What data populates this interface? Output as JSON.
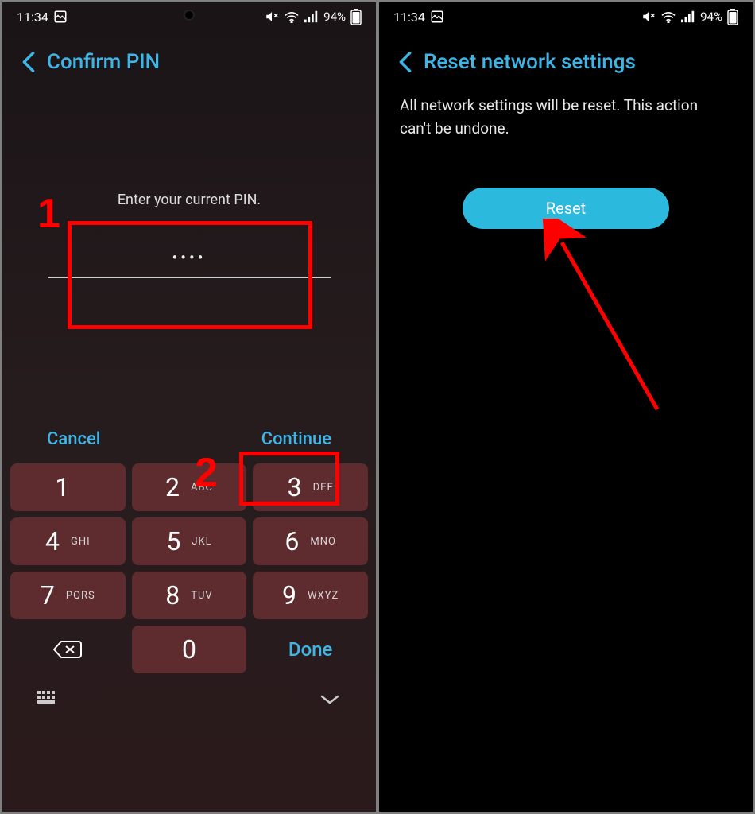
{
  "status": {
    "time": "11:34",
    "battery": "94%"
  },
  "left": {
    "title": "Confirm PIN",
    "prompt": "Enter your current PIN.",
    "dots": "••••",
    "cancel": "Cancel",
    "continue": "Continue",
    "keys": [
      {
        "num": "1",
        "letters": ""
      },
      {
        "num": "2",
        "letters": "ABC"
      },
      {
        "num": "3",
        "letters": "DEF"
      },
      {
        "num": "4",
        "letters": "GHI"
      },
      {
        "num": "5",
        "letters": "JKL"
      },
      {
        "num": "6",
        "letters": "MNO"
      },
      {
        "num": "7",
        "letters": "PQRS"
      },
      {
        "num": "8",
        "letters": "TUV"
      },
      {
        "num": "9",
        "letters": "WXYZ"
      }
    ],
    "zero": "0",
    "done": "Done",
    "anno1": "1",
    "anno2": "2"
  },
  "right": {
    "title": "Reset network settings",
    "body": "All network settings will be reset. This action can't be undone.",
    "reset": "Reset"
  }
}
